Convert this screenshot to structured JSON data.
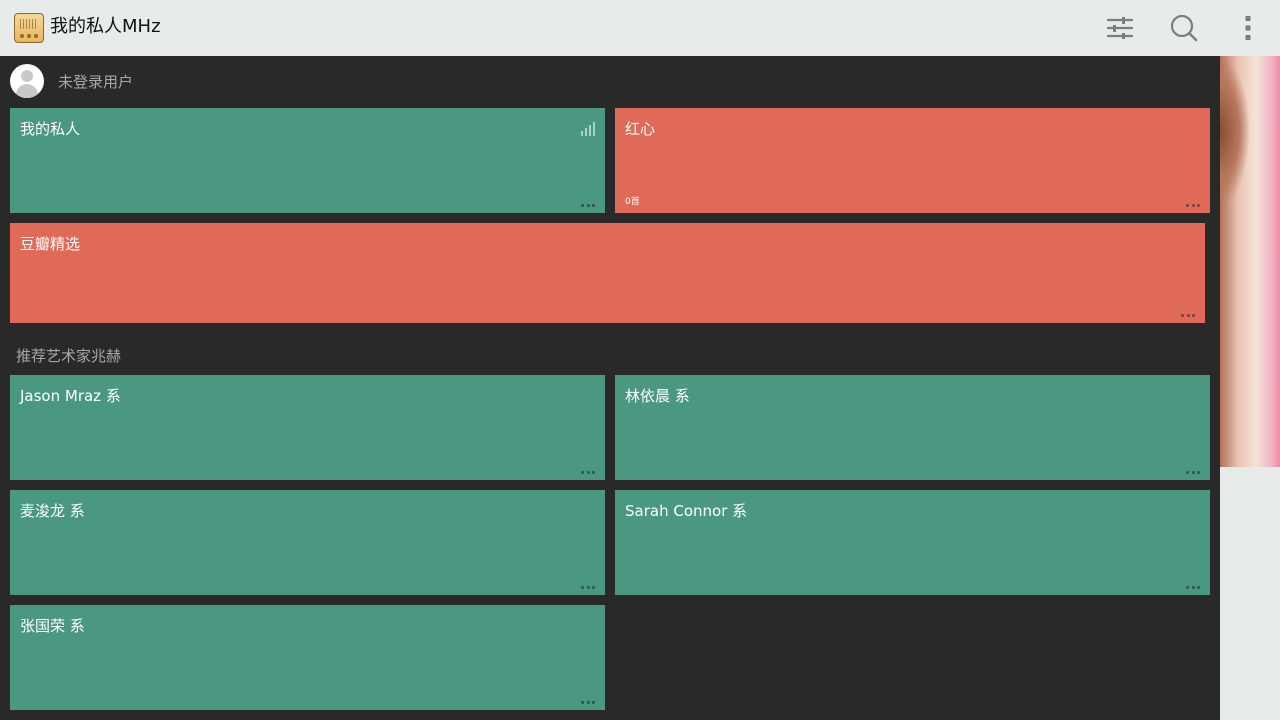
{
  "app": {
    "title": "我的私人MHz"
  },
  "toolbar": {
    "icons": [
      "filter-icon",
      "search-icon",
      "more-vert-icon"
    ]
  },
  "user": {
    "name": "未登录用户"
  },
  "channels": [
    {
      "title": "我的私人",
      "color": "#4a9782",
      "playing": true
    },
    {
      "title": "红心",
      "subtitle": "0首",
      "color": "#e06a58"
    },
    {
      "title": "豆瓣精选",
      "color": "#e06a58"
    }
  ],
  "recommend": {
    "title": "推荐艺术家兆赫",
    "items": [
      {
        "title": "Jason Mraz 系"
      },
      {
        "title": "林依晨 系"
      },
      {
        "title": "麦浚龙 系"
      },
      {
        "title": "Sarah Connor 系"
      },
      {
        "title": "张国荣 系"
      }
    ]
  },
  "colors": {
    "topbar": "#e7ecea",
    "background": "#292929",
    "green": "#4a9782",
    "red": "#e06a58"
  }
}
